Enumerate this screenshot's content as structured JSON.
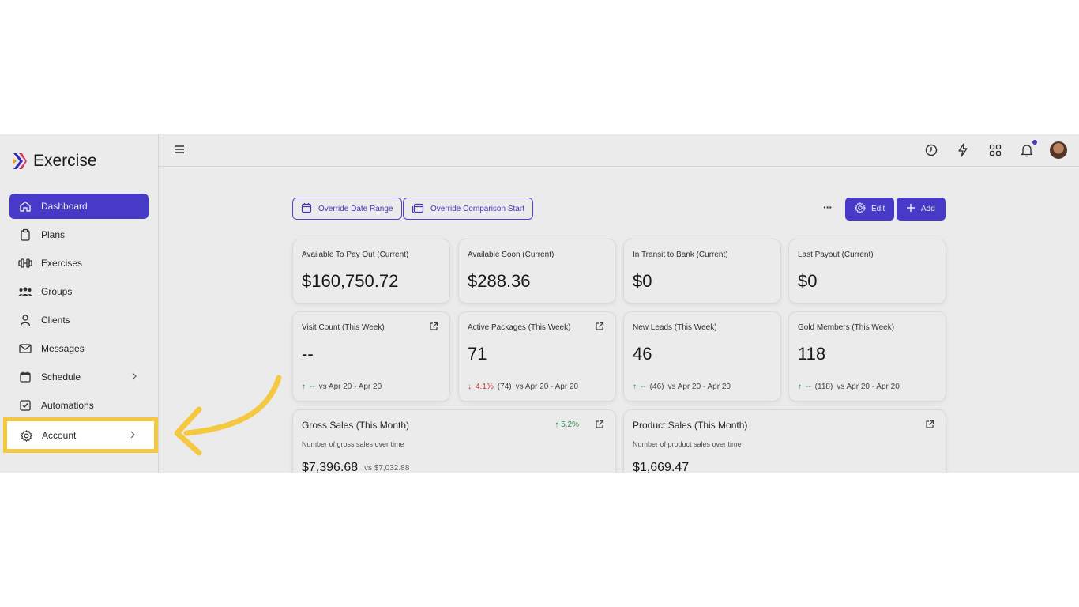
{
  "app": {
    "name": "Exercise"
  },
  "sidebar": {
    "items": [
      {
        "label": "Dashboard",
        "icon": "home-icon",
        "active": true
      },
      {
        "label": "Plans",
        "icon": "clipboard-icon"
      },
      {
        "label": "Exercises",
        "icon": "dumbbell-icon"
      },
      {
        "label": "Groups",
        "icon": "users-icon"
      },
      {
        "label": "Clients",
        "icon": "user-icon"
      },
      {
        "label": "Messages",
        "icon": "mail-icon"
      },
      {
        "label": "Schedule",
        "icon": "calendar-icon",
        "has_submenu": true
      },
      {
        "label": "Automations",
        "icon": "checkbox-icon"
      },
      {
        "label": "Account",
        "icon": "gear-icon",
        "has_submenu": true,
        "highlighted": true
      }
    ]
  },
  "toolbar": {
    "override_date_range": "Override Date Range",
    "override_comparison_start": "Override Comparison Start",
    "more": "···",
    "edit": "Edit",
    "add": "Add"
  },
  "cards_row1": [
    {
      "title": "Available To Pay Out (Current)",
      "value": "$160,750.72"
    },
    {
      "title": "Available Soon (Current)",
      "value": "$288.36"
    },
    {
      "title": "In Transit to Bank (Current)",
      "value": "$0"
    },
    {
      "title": "Last Payout (Current)",
      "value": "$0"
    }
  ],
  "cards_row2": [
    {
      "title": "Visit Count (This Week)",
      "value": "--",
      "trend_dir": "up",
      "trend_pct": "--",
      "trend_prev": "",
      "trend_range": "vs Apr 20 - Apr 20"
    },
    {
      "title": "Active Packages (This Week)",
      "value": "71",
      "trend_dir": "down",
      "trend_pct": "4.1%",
      "trend_prev": "(74)",
      "trend_range": "vs Apr 20 - Apr 20"
    },
    {
      "title": "New Leads (This Week)",
      "value": "46",
      "trend_dir": "up",
      "trend_pct": "--",
      "trend_prev": "(46)",
      "trend_range": "vs Apr 20 - Apr 20"
    },
    {
      "title": "Gold Members (This Week)",
      "value": "118",
      "trend_dir": "up",
      "trend_pct": "--",
      "trend_prev": "(118)",
      "trend_range": "vs Apr 20 - Apr 20"
    }
  ],
  "cards_row3": [
    {
      "title": "Gross Sales (This Month)",
      "trend_pct": "5.2%",
      "subtitle": "Number of gross sales over time",
      "value": "$7,396.68",
      "compare": "vs $7,032.88"
    },
    {
      "title": "Product Sales (This Month)",
      "subtitle": "Number of product sales over time",
      "value": "$1,669.47"
    }
  ],
  "colors": {
    "accent": "#4f3fd9",
    "highlight": "#f5c842",
    "up": "#2e9a5b",
    "down": "#d03a3a"
  }
}
